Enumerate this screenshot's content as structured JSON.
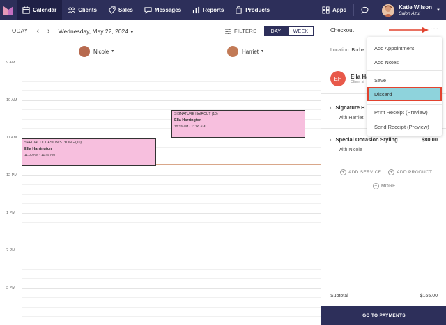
{
  "nav": {
    "items": [
      {
        "label": "Calendar",
        "icon": "calendar-icon"
      },
      {
        "label": "Clients",
        "icon": "clients-icon"
      },
      {
        "label": "Sales",
        "icon": "tag-icon"
      },
      {
        "label": "Messages",
        "icon": "message-icon"
      },
      {
        "label": "Reports",
        "icon": "chart-icon"
      },
      {
        "label": "Products",
        "icon": "product-icon"
      }
    ],
    "apps": "Apps",
    "user_name": "Katie Wilson",
    "user_salon": "Salon Azul"
  },
  "toolbar": {
    "today": "TODAY",
    "date": "Wednesday, May 22, 2024",
    "filters": "FILTERS",
    "day": "DAY",
    "week": "WEEK"
  },
  "staff": [
    "Nicole",
    "Harriet"
  ],
  "times": [
    "9 AM",
    "10 AM",
    "11 AM",
    "12 PM",
    "1 PM",
    "2 PM",
    "3 PM"
  ],
  "appointments": [
    {
      "service": "SIGNATURE HAIRCUT",
      "suffix": "(10)",
      "client": "Ella Harrington",
      "time": "10:15 AM - 11:00 AM"
    },
    {
      "service": "SPECIAL OCCASION STYLING",
      "suffix": "(10)",
      "client": "Ella Harrington",
      "time": "11:00 AM - 11:45 AM"
    }
  ],
  "checkout": {
    "title": "Checkout",
    "location_label": "Location:",
    "location_value": "Burba",
    "client_initials": "EH",
    "client_name": "Ella Ha",
    "client_sub": "Client si",
    "services": [
      {
        "name": "Signature H",
        "with": "with Harriet",
        "price": ""
      },
      {
        "name": "Special Occasion Styling",
        "with": "with Nicole",
        "price": "$80.00"
      }
    ],
    "add_service": "ADD SERVICE",
    "add_product": "ADD PRODUCT",
    "more": "MORE",
    "subtotal_label": "Subtotal",
    "subtotal_value": "$165.00",
    "pay": "GO TO PAYMENTS"
  },
  "menu": {
    "add_appointment": "Add Appointment",
    "add_notes": "Add Notes",
    "save": "Save",
    "discard": "Discard",
    "print_receipt": "Print Receipt (Preview)",
    "send_receipt": "Send Receipt (Preview)"
  },
  "colors": {
    "nav_bg": "#2d2f5a",
    "appointment": "#f7bfde",
    "highlight": "#8ed3dc",
    "annotation": "#e2432f"
  }
}
